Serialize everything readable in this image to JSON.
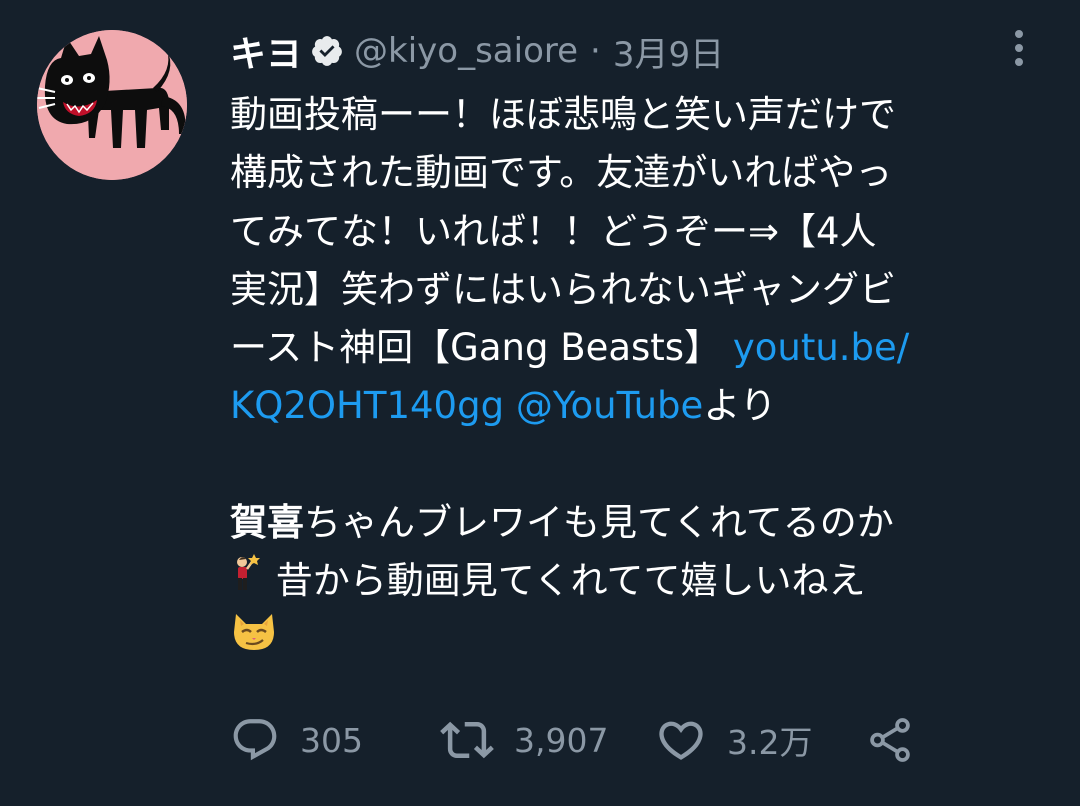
{
  "tweet": {
    "display_name": "キヨ",
    "handle": "@kiyo_saiore",
    "separator": "·",
    "timestamp": "3月9日",
    "lines": [
      "動画投稿ーー！ほぼ悲鳴と笑い声だけで",
      "構成された動画です。友達がいればやっ",
      "てみてな！いれば！！どうぞー⇒【4人",
      "実況】笑わずにはいられないギャングビ",
      "ースト神回【Gang Beasts】 "
    ],
    "link_part1": "youtu.be/",
    "link_part2": "KQ2OHT140gg",
    "mention": "@YouTube",
    "after_mention": "より",
    "second_para_bold": "賀喜",
    "second_para_rest": "ちゃんブレワイも見てくれてるのか",
    "third_line_text": "昔から動画見てくれてて嬉しいねえ"
  },
  "actions": {
    "reply_count": "305",
    "retweet_count": "3,907",
    "like_count": "3.2万"
  },
  "icons": {
    "verified": "verified-badge-icon",
    "more": "more-options-icon",
    "reply": "reply-icon",
    "retweet": "retweet-icon",
    "like": "like-icon",
    "share": "share-icon",
    "emoji1": "person-celebrating-emoji",
    "emoji2": "smirking-cat-emoji"
  },
  "colors": {
    "background": "#15202b",
    "text": "#ffffff",
    "secondary": "#8b98a5",
    "link": "#1d9bf0",
    "avatar_bg": "#f0a9ae"
  }
}
